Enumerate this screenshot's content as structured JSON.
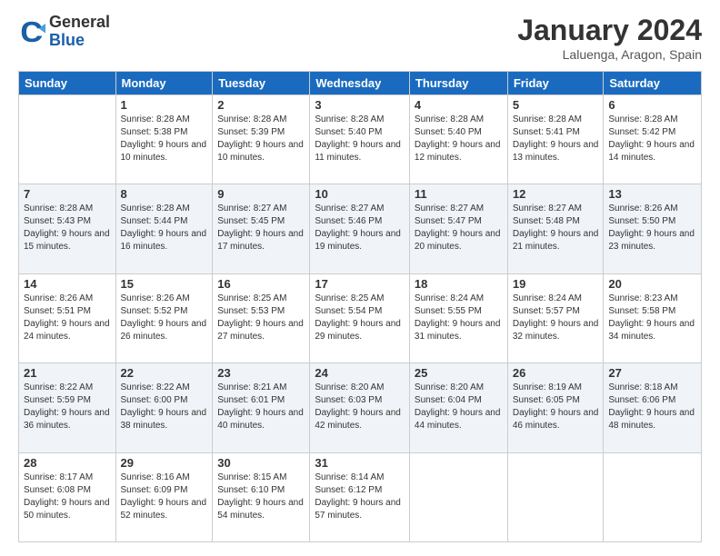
{
  "header": {
    "logo_general": "General",
    "logo_blue": "Blue",
    "month_title": "January 2024",
    "location": "Laluenga, Aragon, Spain"
  },
  "weekdays": [
    "Sunday",
    "Monday",
    "Tuesday",
    "Wednesday",
    "Thursday",
    "Friday",
    "Saturday"
  ],
  "weeks": [
    [
      {
        "day": "",
        "sunrise": "",
        "sunset": "",
        "daylight": ""
      },
      {
        "day": "1",
        "sunrise": "Sunrise: 8:28 AM",
        "sunset": "Sunset: 5:38 PM",
        "daylight": "Daylight: 9 hours and 10 minutes."
      },
      {
        "day": "2",
        "sunrise": "Sunrise: 8:28 AM",
        "sunset": "Sunset: 5:39 PM",
        "daylight": "Daylight: 9 hours and 10 minutes."
      },
      {
        "day": "3",
        "sunrise": "Sunrise: 8:28 AM",
        "sunset": "Sunset: 5:40 PM",
        "daylight": "Daylight: 9 hours and 11 minutes."
      },
      {
        "day": "4",
        "sunrise": "Sunrise: 8:28 AM",
        "sunset": "Sunset: 5:40 PM",
        "daylight": "Daylight: 9 hours and 12 minutes."
      },
      {
        "day": "5",
        "sunrise": "Sunrise: 8:28 AM",
        "sunset": "Sunset: 5:41 PM",
        "daylight": "Daylight: 9 hours and 13 minutes."
      },
      {
        "day": "6",
        "sunrise": "Sunrise: 8:28 AM",
        "sunset": "Sunset: 5:42 PM",
        "daylight": "Daylight: 9 hours and 14 minutes."
      }
    ],
    [
      {
        "day": "7",
        "sunrise": "Sunrise: 8:28 AM",
        "sunset": "Sunset: 5:43 PM",
        "daylight": "Daylight: 9 hours and 15 minutes."
      },
      {
        "day": "8",
        "sunrise": "Sunrise: 8:28 AM",
        "sunset": "Sunset: 5:44 PM",
        "daylight": "Daylight: 9 hours and 16 minutes."
      },
      {
        "day": "9",
        "sunrise": "Sunrise: 8:27 AM",
        "sunset": "Sunset: 5:45 PM",
        "daylight": "Daylight: 9 hours and 17 minutes."
      },
      {
        "day": "10",
        "sunrise": "Sunrise: 8:27 AM",
        "sunset": "Sunset: 5:46 PM",
        "daylight": "Daylight: 9 hours and 19 minutes."
      },
      {
        "day": "11",
        "sunrise": "Sunrise: 8:27 AM",
        "sunset": "Sunset: 5:47 PM",
        "daylight": "Daylight: 9 hours and 20 minutes."
      },
      {
        "day": "12",
        "sunrise": "Sunrise: 8:27 AM",
        "sunset": "Sunset: 5:48 PM",
        "daylight": "Daylight: 9 hours and 21 minutes."
      },
      {
        "day": "13",
        "sunrise": "Sunrise: 8:26 AM",
        "sunset": "Sunset: 5:50 PM",
        "daylight": "Daylight: 9 hours and 23 minutes."
      }
    ],
    [
      {
        "day": "14",
        "sunrise": "Sunrise: 8:26 AM",
        "sunset": "Sunset: 5:51 PM",
        "daylight": "Daylight: 9 hours and 24 minutes."
      },
      {
        "day": "15",
        "sunrise": "Sunrise: 8:26 AM",
        "sunset": "Sunset: 5:52 PM",
        "daylight": "Daylight: 9 hours and 26 minutes."
      },
      {
        "day": "16",
        "sunrise": "Sunrise: 8:25 AM",
        "sunset": "Sunset: 5:53 PM",
        "daylight": "Daylight: 9 hours and 27 minutes."
      },
      {
        "day": "17",
        "sunrise": "Sunrise: 8:25 AM",
        "sunset": "Sunset: 5:54 PM",
        "daylight": "Daylight: 9 hours and 29 minutes."
      },
      {
        "day": "18",
        "sunrise": "Sunrise: 8:24 AM",
        "sunset": "Sunset: 5:55 PM",
        "daylight": "Daylight: 9 hours and 31 minutes."
      },
      {
        "day": "19",
        "sunrise": "Sunrise: 8:24 AM",
        "sunset": "Sunset: 5:57 PM",
        "daylight": "Daylight: 9 hours and 32 minutes."
      },
      {
        "day": "20",
        "sunrise": "Sunrise: 8:23 AM",
        "sunset": "Sunset: 5:58 PM",
        "daylight": "Daylight: 9 hours and 34 minutes."
      }
    ],
    [
      {
        "day": "21",
        "sunrise": "Sunrise: 8:22 AM",
        "sunset": "Sunset: 5:59 PM",
        "daylight": "Daylight: 9 hours and 36 minutes."
      },
      {
        "day": "22",
        "sunrise": "Sunrise: 8:22 AM",
        "sunset": "Sunset: 6:00 PM",
        "daylight": "Daylight: 9 hours and 38 minutes."
      },
      {
        "day": "23",
        "sunrise": "Sunrise: 8:21 AM",
        "sunset": "Sunset: 6:01 PM",
        "daylight": "Daylight: 9 hours and 40 minutes."
      },
      {
        "day": "24",
        "sunrise": "Sunrise: 8:20 AM",
        "sunset": "Sunset: 6:03 PM",
        "daylight": "Daylight: 9 hours and 42 minutes."
      },
      {
        "day": "25",
        "sunrise": "Sunrise: 8:20 AM",
        "sunset": "Sunset: 6:04 PM",
        "daylight": "Daylight: 9 hours and 44 minutes."
      },
      {
        "day": "26",
        "sunrise": "Sunrise: 8:19 AM",
        "sunset": "Sunset: 6:05 PM",
        "daylight": "Daylight: 9 hours and 46 minutes."
      },
      {
        "day": "27",
        "sunrise": "Sunrise: 8:18 AM",
        "sunset": "Sunset: 6:06 PM",
        "daylight": "Daylight: 9 hours and 48 minutes."
      }
    ],
    [
      {
        "day": "28",
        "sunrise": "Sunrise: 8:17 AM",
        "sunset": "Sunset: 6:08 PM",
        "daylight": "Daylight: 9 hours and 50 minutes."
      },
      {
        "day": "29",
        "sunrise": "Sunrise: 8:16 AM",
        "sunset": "Sunset: 6:09 PM",
        "daylight": "Daylight: 9 hours and 52 minutes."
      },
      {
        "day": "30",
        "sunrise": "Sunrise: 8:15 AM",
        "sunset": "Sunset: 6:10 PM",
        "daylight": "Daylight: 9 hours and 54 minutes."
      },
      {
        "day": "31",
        "sunrise": "Sunrise: 8:14 AM",
        "sunset": "Sunset: 6:12 PM",
        "daylight": "Daylight: 9 hours and 57 minutes."
      },
      {
        "day": "",
        "sunrise": "",
        "sunset": "",
        "daylight": ""
      },
      {
        "day": "",
        "sunrise": "",
        "sunset": "",
        "daylight": ""
      },
      {
        "day": "",
        "sunrise": "",
        "sunset": "",
        "daylight": ""
      }
    ]
  ]
}
